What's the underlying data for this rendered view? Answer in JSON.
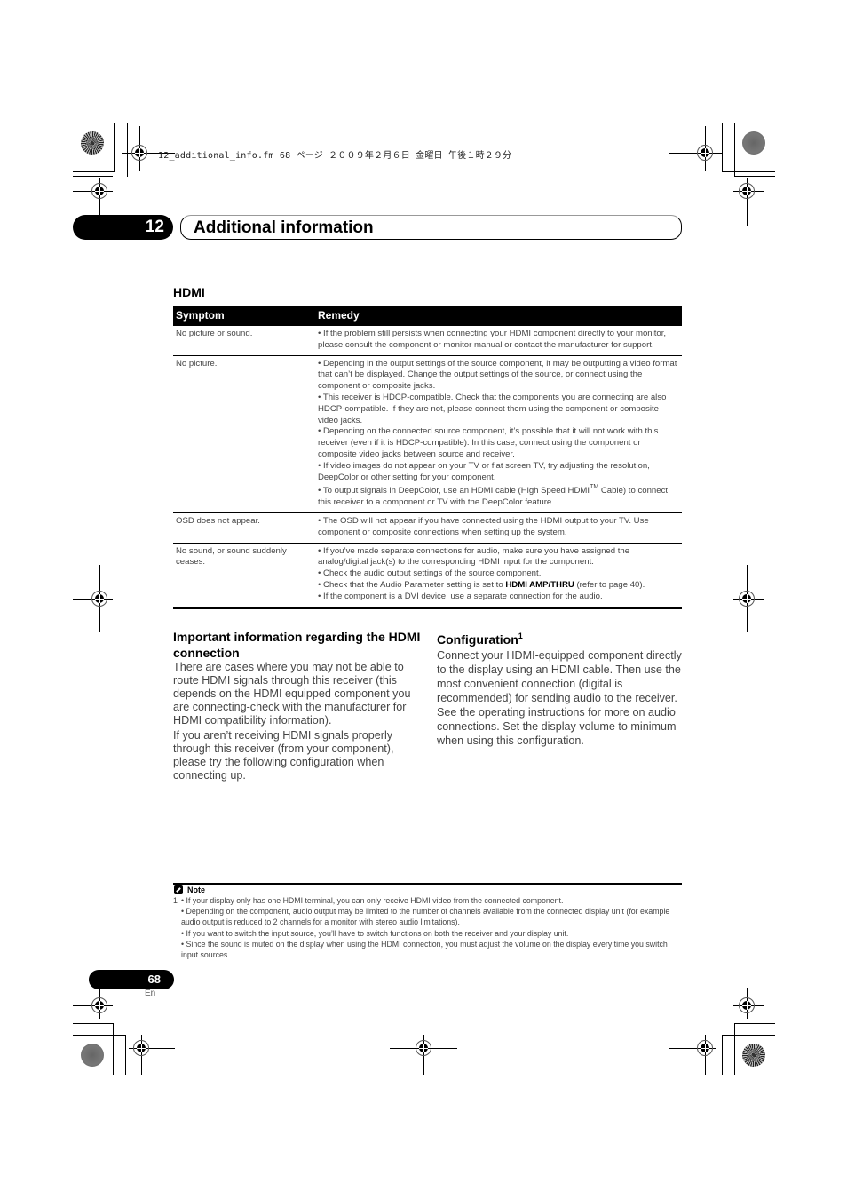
{
  "print_header": "12_additional_info.fm  68 ページ  ２００９年２月６日  金曜日  午後１時２９分",
  "chapter": {
    "number": "12",
    "title": "Additional information"
  },
  "section_title": "HDMI",
  "table": {
    "headers": {
      "symptom": "Symptom",
      "remedy": "Remedy"
    },
    "rows": [
      {
        "symptom": "No picture or sound.",
        "remedies": [
          "• If the problem still persists when connecting your HDMI component directly to your monitor, please consult the component or monitor manual or contact the manufacturer for support."
        ]
      },
      {
        "symptom": "No picture.",
        "remedies": [
          "• Depending in the output settings of the source component, it may be outputting a video format that can’t be displayed. Change the output settings of the source, or connect using the component or composite jacks.",
          "• This receiver is HDCP-compatible. Check that the components you are connecting are also HDCP-compatible. If they are not, please connect them using the component or composite video jacks.",
          "• Depending on the connected source component, it’s possible that it will not work with this receiver (even if it is HDCP-compatible). In this case, connect using the component or composite video jacks between source and receiver.",
          "• If video images do not appear on your TV or flat screen TV, try adjusting the resolution, DeepColor or other setting for your component."
        ],
        "tm_remedy": {
          "before": "• To output signals in DeepColor, use an HDMI cable (High Speed HDMI",
          "sup": "TM",
          "after": " Cable) to connect this receiver to a component or TV with the DeepColor feature."
        }
      },
      {
        "symptom": "OSD does not appear.",
        "remedies": [
          "• The OSD will not appear if you have connected using the HDMI output to your TV. Use component or composite connections when setting up the system."
        ]
      },
      {
        "symptom": "No sound, or sound suddenly ceases.",
        "remedies": [
          "• If you’ve made separate connections for audio, make sure you have assigned the analog/digital jack(s) to the corresponding HDMI input for the component.",
          "• Check the audio output settings of the source component."
        ],
        "bold_remedy": {
          "before": "• Check that the Audio Parameter setting is set to ",
          "bold": "HDMI AMP/THRU",
          "after": " (refer to page 40)."
        },
        "last_remedy": "• If the component is a DVI device, use a separate connection for the audio."
      }
    ]
  },
  "important": {
    "heading": "Important information regarding the HDMI connection",
    "paragraphs": [
      "There are cases where you may not be able to route HDMI signals through this receiver (this depends on the HDMI equipped component you are connecting-check with the manufacturer for HDMI compatibility information).",
      "If you aren’t receiving HDMI signals properly through this receiver (from your component), please try the following configuration when connecting up."
    ]
  },
  "configuration": {
    "heading": "Configuration",
    "footnote_ref": "1",
    "text": "Connect your HDMI-equipped component directly to the display using an HDMI cable. Then use the most convenient connection (digital is recommended) for sending audio to the receiver. See the operating instructions for more on audio connections. Set the display volume to minimum when using this configuration."
  },
  "note": {
    "label": "Note",
    "icon": "note-pencil-icon",
    "number": "1",
    "items": [
      "• If your display only has one HDMI terminal, you can only receive HDMI video from the connected component.",
      "• Depending on the component, audio output may be limited to the number of channels available from the connected display unit (for example audio output is reduced to 2 channels for a monitor with stereo audio limitations).",
      "• If you want to switch the input source, you’ll have to switch functions on both the receiver and your display unit.",
      "• Since the sound is muted on the display when using the HDMI connection, you must adjust the volume on the display every time you switch input sources."
    ]
  },
  "footer": {
    "page_number": "68",
    "language": "En"
  }
}
